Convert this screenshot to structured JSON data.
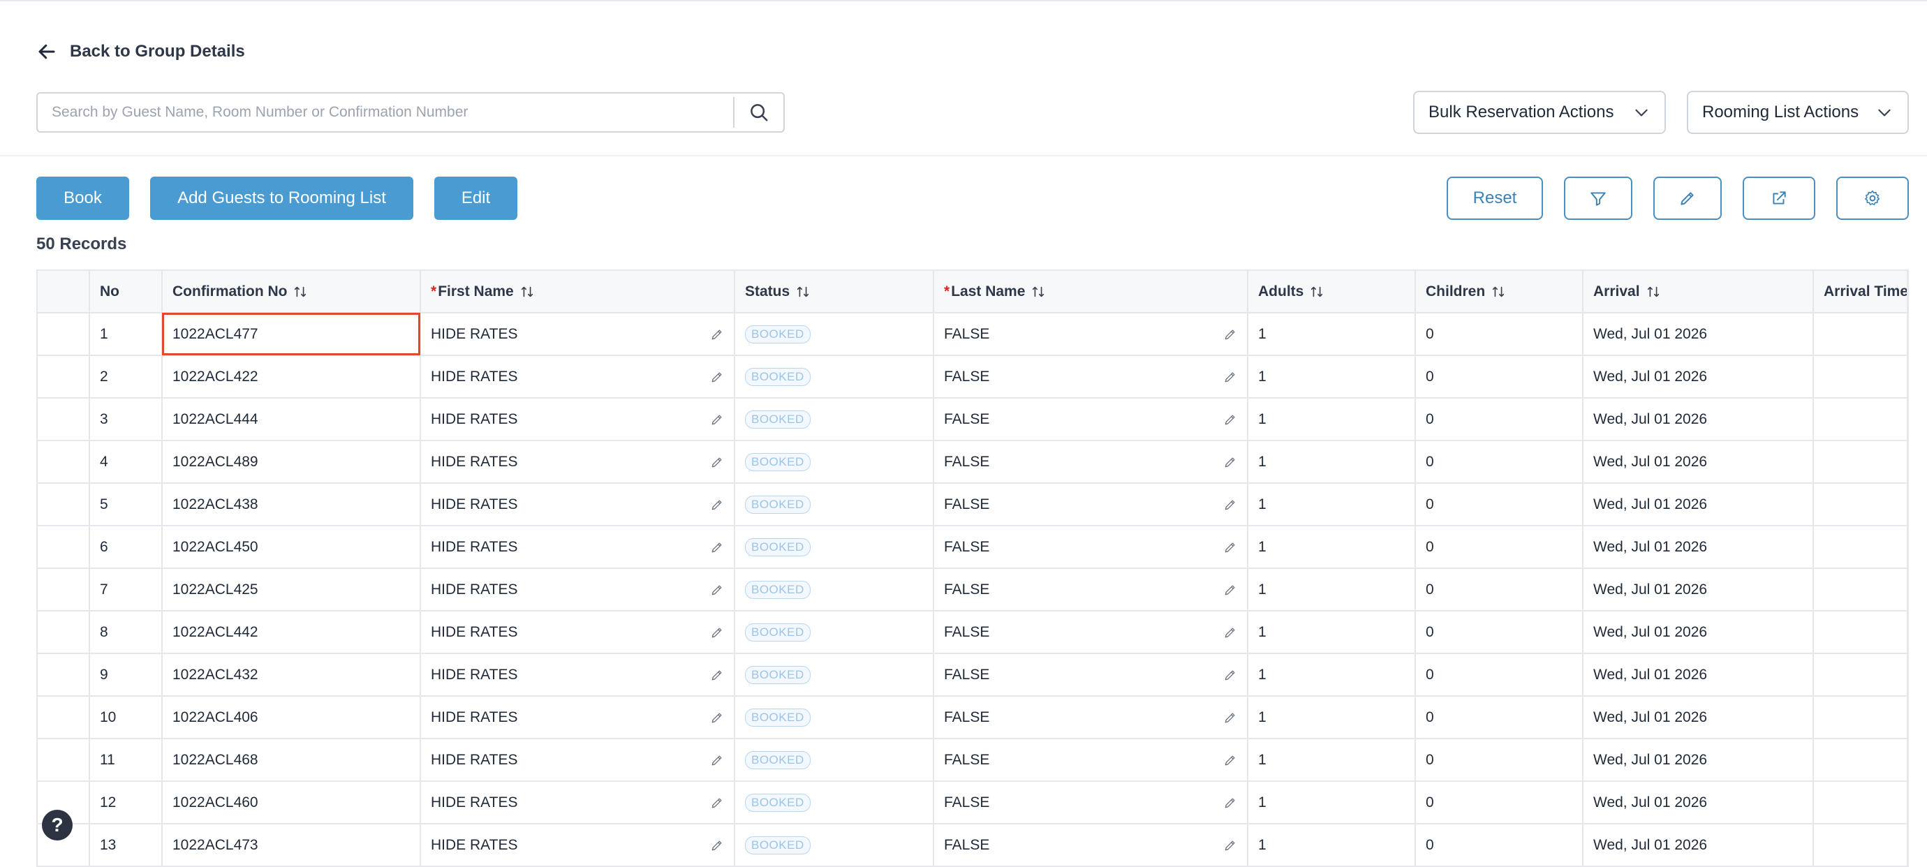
{
  "back_link": {
    "label": "Back to Group Details",
    "icon": "arrow-left-icon"
  },
  "search": {
    "placeholder": "Search by Guest Name, Room Number or Confirmation Number",
    "value": "",
    "icon": "search-icon"
  },
  "dropdowns": {
    "bulk_label": "Bulk Reservation Actions",
    "rooming_label": "Rooming List Actions"
  },
  "toolbar": {
    "book_label": "Book",
    "add_guests_label": "Add Guests to Rooming List",
    "edit_label": "Edit",
    "reset_label": "Reset",
    "icons": [
      "filter-icon",
      "pencil-icon",
      "external-link-icon",
      "gear-icon"
    ]
  },
  "records_label": "50 Records",
  "table": {
    "columns": {
      "no": "No",
      "confirmation": "Confirmation No",
      "first_name": "First Name",
      "status": "Status",
      "last_name": "Last Name",
      "adults": "Adults",
      "children": "Children",
      "arrival": "Arrival",
      "arrival_time": "Arrival Time"
    },
    "required_marker": "*",
    "rows": [
      {
        "no": "1",
        "confirmation": "1022ACL477",
        "first_name": "HIDE RATES",
        "status": "BOOKED",
        "last_name": "FALSE",
        "adults": "1",
        "children": "0",
        "arrival": "Wed, Jul 01 2026",
        "arrival_time": ""
      },
      {
        "no": "2",
        "confirmation": "1022ACL422",
        "first_name": "HIDE RATES",
        "status": "BOOKED",
        "last_name": "FALSE",
        "adults": "1",
        "children": "0",
        "arrival": "Wed, Jul 01 2026",
        "arrival_time": ""
      },
      {
        "no": "3",
        "confirmation": "1022ACL444",
        "first_name": "HIDE RATES",
        "status": "BOOKED",
        "last_name": "FALSE",
        "adults": "1",
        "children": "0",
        "arrival": "Wed, Jul 01 2026",
        "arrival_time": ""
      },
      {
        "no": "4",
        "confirmation": "1022ACL489",
        "first_name": "HIDE RATES",
        "status": "BOOKED",
        "last_name": "FALSE",
        "adults": "1",
        "children": "0",
        "arrival": "Wed, Jul 01 2026",
        "arrival_time": ""
      },
      {
        "no": "5",
        "confirmation": "1022ACL438",
        "first_name": "HIDE RATES",
        "status": "BOOKED",
        "last_name": "FALSE",
        "adults": "1",
        "children": "0",
        "arrival": "Wed, Jul 01 2026",
        "arrival_time": ""
      },
      {
        "no": "6",
        "confirmation": "1022ACL450",
        "first_name": "HIDE RATES",
        "status": "BOOKED",
        "last_name": "FALSE",
        "adults": "1",
        "children": "0",
        "arrival": "Wed, Jul 01 2026",
        "arrival_time": ""
      },
      {
        "no": "7",
        "confirmation": "1022ACL425",
        "first_name": "HIDE RATES",
        "status": "BOOKED",
        "last_name": "FALSE",
        "adults": "1",
        "children": "0",
        "arrival": "Wed, Jul 01 2026",
        "arrival_time": ""
      },
      {
        "no": "8",
        "confirmation": "1022ACL442",
        "first_name": "HIDE RATES",
        "status": "BOOKED",
        "last_name": "FALSE",
        "adults": "1",
        "children": "0",
        "arrival": "Wed, Jul 01 2026",
        "arrival_time": ""
      },
      {
        "no": "9",
        "confirmation": "1022ACL432",
        "first_name": "HIDE RATES",
        "status": "BOOKED",
        "last_name": "FALSE",
        "adults": "1",
        "children": "0",
        "arrival": "Wed, Jul 01 2026",
        "arrival_time": ""
      },
      {
        "no": "10",
        "confirmation": "1022ACL406",
        "first_name": "HIDE RATES",
        "status": "BOOKED",
        "last_name": "FALSE",
        "adults": "1",
        "children": "0",
        "arrival": "Wed, Jul 01 2026",
        "arrival_time": ""
      },
      {
        "no": "11",
        "confirmation": "1022ACL468",
        "first_name": "HIDE RATES",
        "status": "BOOKED",
        "last_name": "FALSE",
        "adults": "1",
        "children": "0",
        "arrival": "Wed, Jul 01 2026",
        "arrival_time": ""
      },
      {
        "no": "12",
        "confirmation": "1022ACL460",
        "first_name": "HIDE RATES",
        "status": "BOOKED",
        "last_name": "FALSE",
        "adults": "1",
        "children": "0",
        "arrival": "Wed, Jul 01 2026",
        "arrival_time": ""
      },
      {
        "no": "13",
        "confirmation": "1022ACL473",
        "first_name": "HIDE RATES",
        "status": "BOOKED",
        "last_name": "FALSE",
        "adults": "1",
        "children": "0",
        "arrival": "Wed, Jul 01 2026",
        "arrival_time": ""
      }
    ]
  },
  "help_button": {
    "label": "?"
  },
  "colors": {
    "primary": "#4a9bd1",
    "selected_outline": "#e0492f",
    "badge_text": "#9dc4e6",
    "required": "#dc2626"
  }
}
